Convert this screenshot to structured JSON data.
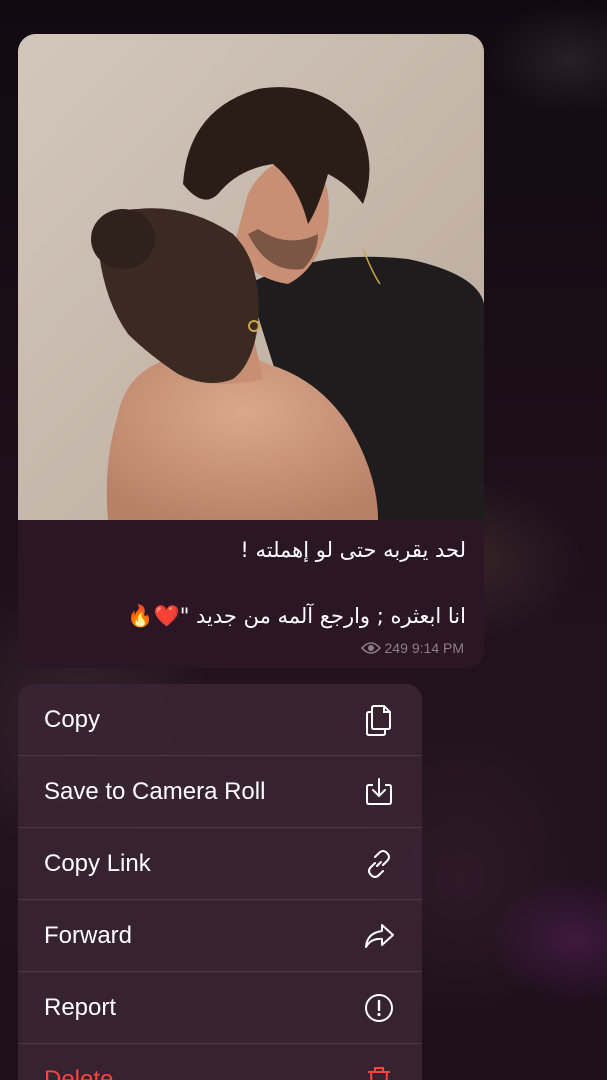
{
  "message": {
    "caption_line1": "لحد يقربه حتى لو إهملته !",
    "caption_line2": "انا ابعثره ; وارجع آلمه من جديد \"❤️🔥",
    "views": "249",
    "time": "9:14 PM"
  },
  "context_menu": {
    "items": [
      {
        "label": "Copy",
        "icon": "copy-icon"
      },
      {
        "label": "Save to Camera Roll",
        "icon": "save-download-icon"
      },
      {
        "label": "Copy Link",
        "icon": "link-icon"
      },
      {
        "label": "Forward",
        "icon": "forward-arrow-icon"
      },
      {
        "label": "Report",
        "icon": "exclamation-circle-icon"
      },
      {
        "label": "Delete",
        "icon": "trash-icon"
      }
    ]
  },
  "colors": {
    "background": "#1a0d16",
    "bubble": "#2b1626",
    "menu": "#3a2434",
    "danger": "#ff453a",
    "meta_text": "#8d7f89"
  }
}
